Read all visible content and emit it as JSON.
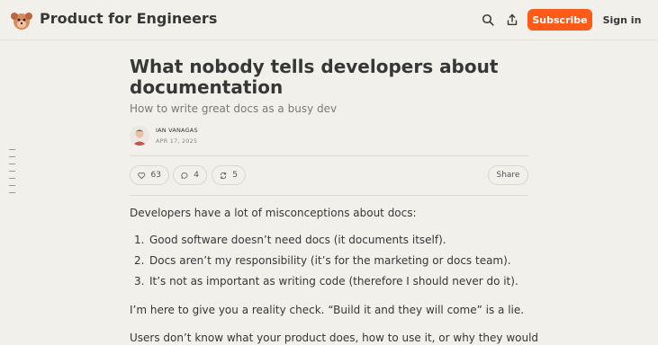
{
  "header": {
    "publication_name": "Product for Engineers",
    "subscribe_label": "Subscribe",
    "signin_label": "Sign in",
    "search_icon": "search-icon",
    "share_icon": "share-icon",
    "accent_color": "#ff5a18"
  },
  "post": {
    "title": "What nobody tells developers about documentation",
    "subtitle": "How to write great docs as a busy dev",
    "author": "IAN VANAGAS",
    "date": "APR 17, 2025",
    "likes": "63",
    "comments": "4",
    "restacks": "5",
    "share_label": "Share"
  },
  "body": {
    "intro": "Developers have a lot of misconceptions about docs:",
    "list": [
      {
        "num": "1.",
        "text": "Good software doesn’t need docs (it documents itself)."
      },
      {
        "num": "2.",
        "text": "Docs aren’t my responsibility (it’s for the marketing or docs team)."
      },
      {
        "num": "3.",
        "text": "It’s not as important as writing code (therefore I should never do it)."
      }
    ],
    "para2": "I’m here to give you a reality check. “Build it and they will come” is a lie.",
    "para3": "Users don’t know what your product does, how to use it, or why they would"
  }
}
